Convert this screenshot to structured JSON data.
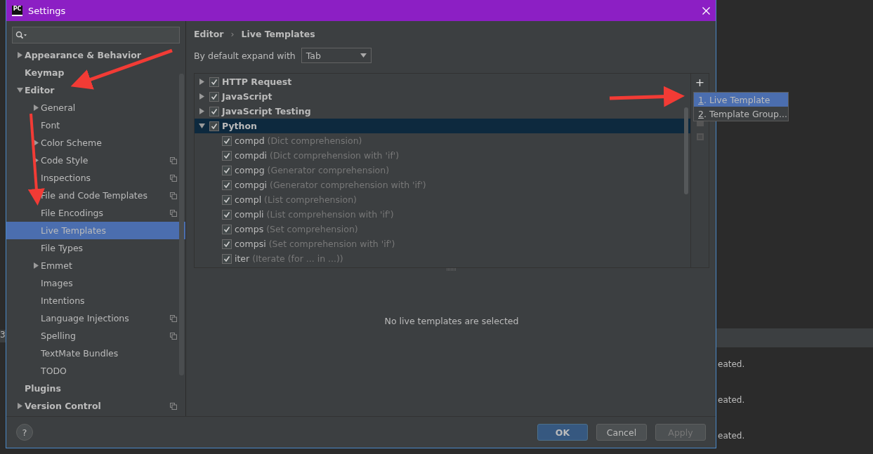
{
  "window": {
    "logo_text": "PC",
    "title": "Settings"
  },
  "sidebar": {
    "items": [
      {
        "label": "Appearance & Behavior",
        "bold": true,
        "expanded": false,
        "has_children": true,
        "selected": false,
        "project_icon": false
      },
      {
        "label": "Keymap",
        "bold": true,
        "has_children": false,
        "selected": false,
        "project_icon": false
      },
      {
        "label": "Editor",
        "bold": true,
        "expanded": true,
        "has_children": true,
        "selected": false,
        "project_icon": false,
        "children": [
          {
            "label": "General",
            "has_children": true,
            "expanded": false,
            "selected": false,
            "project_icon": false
          },
          {
            "label": "Font",
            "has_children": false,
            "selected": false,
            "project_icon": false
          },
          {
            "label": "Color Scheme",
            "has_children": true,
            "expanded": false,
            "selected": false,
            "project_icon": false
          },
          {
            "label": "Code Style",
            "has_children": true,
            "expanded": false,
            "selected": false,
            "project_icon": true
          },
          {
            "label": "Inspections",
            "has_children": false,
            "selected": false,
            "project_icon": true
          },
          {
            "label": "File and Code Templates",
            "has_children": false,
            "selected": false,
            "project_icon": true
          },
          {
            "label": "File Encodings",
            "has_children": false,
            "selected": false,
            "project_icon": true
          },
          {
            "label": "Live Templates",
            "has_children": false,
            "selected": true,
            "project_icon": false
          },
          {
            "label": "File Types",
            "has_children": false,
            "selected": false,
            "project_icon": false
          },
          {
            "label": "Emmet",
            "has_children": true,
            "expanded": false,
            "selected": false,
            "project_icon": false
          },
          {
            "label": "Images",
            "has_children": false,
            "selected": false,
            "project_icon": false
          },
          {
            "label": "Intentions",
            "has_children": false,
            "selected": false,
            "project_icon": false
          },
          {
            "label": "Language Injections",
            "has_children": false,
            "selected": false,
            "project_icon": true
          },
          {
            "label": "Spelling",
            "has_children": false,
            "selected": false,
            "project_icon": true
          },
          {
            "label": "TextMate Bundles",
            "has_children": false,
            "selected": false,
            "project_icon": false
          },
          {
            "label": "TODO",
            "has_children": false,
            "selected": false,
            "project_icon": false
          }
        ]
      },
      {
        "label": "Plugins",
        "bold": true,
        "has_children": false,
        "selected": false,
        "project_icon": false
      },
      {
        "label": "Version Control",
        "bold": true,
        "expanded": false,
        "has_children": true,
        "selected": false,
        "project_icon": true
      }
    ]
  },
  "breadcrumb": {
    "parent": "Editor",
    "separator": "›",
    "current": "Live Templates"
  },
  "expand_with": {
    "label": "By default expand with",
    "value": "Tab"
  },
  "templates": [
    {
      "name": "HTTP Request",
      "checked": true,
      "expanded": false,
      "selected": false
    },
    {
      "name": "JavaScript",
      "checked": true,
      "expanded": false,
      "selected": false
    },
    {
      "name": "JavaScript Testing",
      "checked": true,
      "expanded": false,
      "selected": false
    },
    {
      "name": "Python",
      "checked": true,
      "expanded": true,
      "selected": true,
      "children": [
        {
          "abbr": "compd",
          "description": "(Dict comprehension)",
          "checked": true
        },
        {
          "abbr": "compdi",
          "description": "(Dict comprehension with 'if')",
          "checked": true
        },
        {
          "abbr": "compg",
          "description": "(Generator comprehension)",
          "checked": true
        },
        {
          "abbr": "compgi",
          "description": "(Generator comprehension with 'if')",
          "checked": true
        },
        {
          "abbr": "compl",
          "description": "(List comprehension)",
          "checked": true
        },
        {
          "abbr": "compli",
          "description": "(List comprehension with 'if')",
          "checked": true
        },
        {
          "abbr": "comps",
          "description": "(Set comprehension)",
          "checked": true
        },
        {
          "abbr": "compsi",
          "description": "(Set comprehension with 'if')",
          "checked": true
        },
        {
          "abbr": "iter",
          "description": "(Iterate (for ... in ...))",
          "checked": true
        }
      ]
    }
  ],
  "add_menu": [
    {
      "mnemonic": "1",
      "label": ". Live Template",
      "selected": true
    },
    {
      "mnemonic": "2",
      "label": ". Template Group...",
      "selected": false
    }
  ],
  "add_symbol": "+",
  "help_symbol": "?",
  "empty_message": "No live templates are selected",
  "buttons": [
    {
      "label": "OK",
      "kind": "primary",
      "disabled": false
    },
    {
      "label": "Cancel",
      "kind": "normal",
      "disabled": false
    },
    {
      "label": "Apply",
      "kind": "normal",
      "disabled": true
    }
  ],
  "background": {
    "left_text": "3",
    "messages": [
      "eated.",
      "eated.",
      "eated."
    ]
  }
}
